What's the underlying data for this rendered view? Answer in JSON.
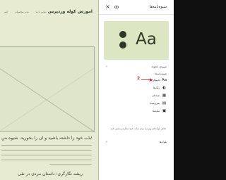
{
  "preview": {
    "site_title": "آموزش کوله وردپرس",
    "nav_items": [
      "درباره",
      "تماس با ما",
      "مدیر محصولی",
      "ایتم"
    ],
    "post_title": "چگونه کباب خود را داشته باشید و آن را بخورید، شیوه من",
    "post_subtitle": "ریشه نگارگری: داستان مردی در نقی"
  },
  "panel": {
    "title": "شیوه‌نامه‌ها",
    "preview_sample": "Aa",
    "variations_label": "شیوه‌ی دلخواه",
    "menu_heading": "شیوه‌نامه‌ها",
    "menu_items": [
      {
        "icon": "typography-icon",
        "glyph": "Aa",
        "label": "تایپوگرافی"
      },
      {
        "icon": "color-icon",
        "glyph": "◐",
        "label": "رنگ‌ها"
      },
      {
        "icon": "layout-icon",
        "glyph": "▦",
        "label": "چیدمان"
      },
      {
        "icon": "background-icon",
        "glyph": "▤",
        "label": "پس‌زمینه"
      },
      {
        "icon": "shadows-icon",
        "glyph": "▣",
        "label": "سایه‌ها"
      }
    ],
    "description": "ظاهر بلوک‌های ویژه را برای سایت خود سفارشی‌سازی کنید.",
    "blocks_label": "بلوک‌ها"
  },
  "annotation": {
    "number": "2",
    "color": "#d93025"
  },
  "colors": {
    "preview_bg": "#e6ebd2",
    "preview_card": "#dce6c3",
    "text_dark": "#2f3a26",
    "panel_bg": "#ffffff",
    "chrome_dark": "#0f0f0f"
  }
}
